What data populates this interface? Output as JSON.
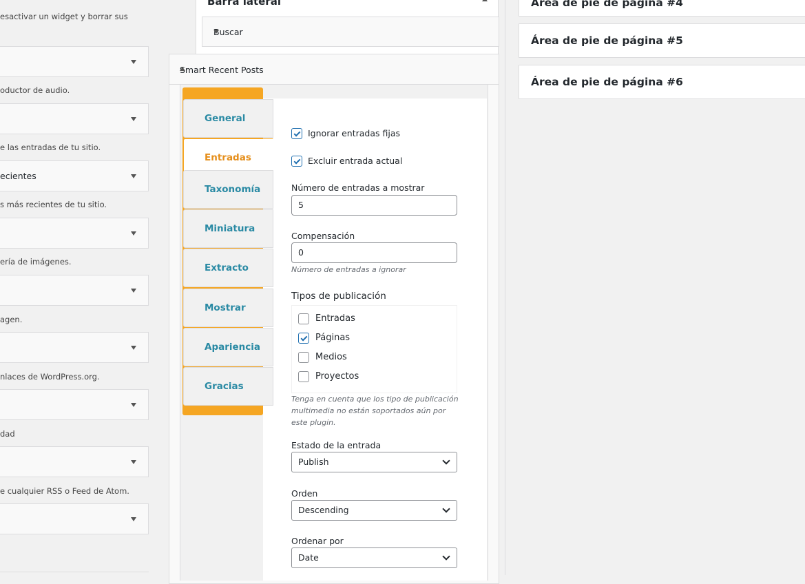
{
  "left": {
    "top_desc": "esactivar un widget y borrar sus",
    "widgets": [
      {
        "label": "",
        "desc": "oductor de audio."
      },
      {
        "label": "",
        "desc": "e las entradas de tu sitio."
      },
      {
        "label": "ecientes",
        "desc": "s más recientes de tu sitio."
      },
      {
        "label": "",
        "desc": "ería de imágenes."
      },
      {
        "label": "",
        "desc": "agen."
      },
      {
        "label": "",
        "desc": "nlaces de WordPress.org."
      },
      {
        "label": "",
        "desc": "dad"
      },
      {
        "label": "",
        "desc": "e cualquier RSS o Feed de Atom."
      },
      {
        "label": "",
        "desc": ""
      }
    ]
  },
  "sidebar": {
    "title": "Barra lateral",
    "search_widget": "Buscar"
  },
  "srp": {
    "title": "Smart Recent Posts",
    "tabs": [
      {
        "label": "General",
        "active": false
      },
      {
        "label": "Entradas",
        "active": true
      },
      {
        "label": "Taxonomía",
        "active": false
      },
      {
        "label": "Miniatura",
        "active": false
      },
      {
        "label": "Extracto",
        "active": false
      },
      {
        "label": "Mostrar",
        "active": false
      },
      {
        "label": "Apariencia",
        "active": false
      },
      {
        "label": "Gracias",
        "active": false
      }
    ],
    "ignore_sticky": {
      "label": "Ignorar entradas fijas",
      "checked": true
    },
    "exclude_current": {
      "label": "Excluir entrada actual",
      "checked": true
    },
    "num_posts": {
      "label": "Número de entradas a mostrar",
      "value": "5"
    },
    "offset": {
      "label": "Compensación",
      "value": "0",
      "hint": "Número de entradas a ignorar"
    },
    "post_types": {
      "label": "Tipos de publicación",
      "options": [
        {
          "label": "Entradas",
          "checked": false
        },
        {
          "label": "Páginas",
          "checked": true
        },
        {
          "label": "Medios",
          "checked": false
        },
        {
          "label": "Proyectos",
          "checked": false
        }
      ],
      "hint": "Tenga en cuenta que los tipo de publicación multimedia no están soportados aún por este plugin."
    },
    "post_status": {
      "label": "Estado de la entrada",
      "value": "Publish"
    },
    "order": {
      "label": "Orden",
      "value": "Descending"
    },
    "orderby": {
      "label": "Ordenar por",
      "value": "Date"
    }
  },
  "footer_areas": [
    "Área de pie de página #4",
    "Área de pie de página #5",
    "Área de pie de página #6"
  ],
  "colors": {
    "accent_orange": "#f5a623",
    "tab_text_blue": "#2a8aa4",
    "checkbox_blue": "#2271b1"
  }
}
